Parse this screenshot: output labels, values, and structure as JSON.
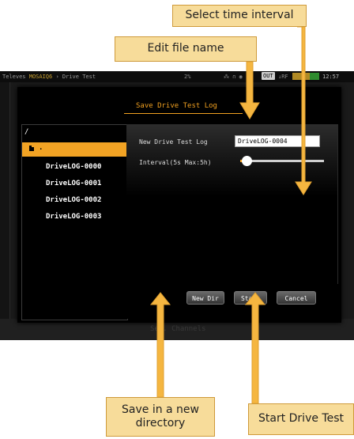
{
  "status_bar": {
    "brand": "Televes",
    "product": "MOSAIQ6",
    "app": "Drive Test",
    "percent": "2%",
    "output": "OUT",
    "rf": "↓RF",
    "time": "12:57"
  },
  "underlay": {
    "bottom_label": "Sel. Channels"
  },
  "dialog": {
    "title": "Save Drive Test Log",
    "path": "/",
    "parent_dir": ".",
    "files": [
      "DriveLOG-0000",
      "DriveLOG-0001",
      "DriveLOG-0002",
      "DriveLOG-0003"
    ],
    "name_label": "New Drive Test Log",
    "name_value": "DriveLOG-0004",
    "interval_label": "Interval(5s Max:5h)",
    "interval_fraction": 0.05,
    "buttons": {
      "new_dir": "New Dir",
      "start": "Start",
      "cancel": "Cancel"
    }
  },
  "callouts": {
    "select_time": "Select time interval",
    "edit_name": "Edit file name",
    "new_dir": "Save in a new directory",
    "start": "Start Drive Test"
  },
  "colors": {
    "accent": "#f2a324",
    "callout_bg": "#f7dc9a",
    "arrow": "#f5b640"
  }
}
